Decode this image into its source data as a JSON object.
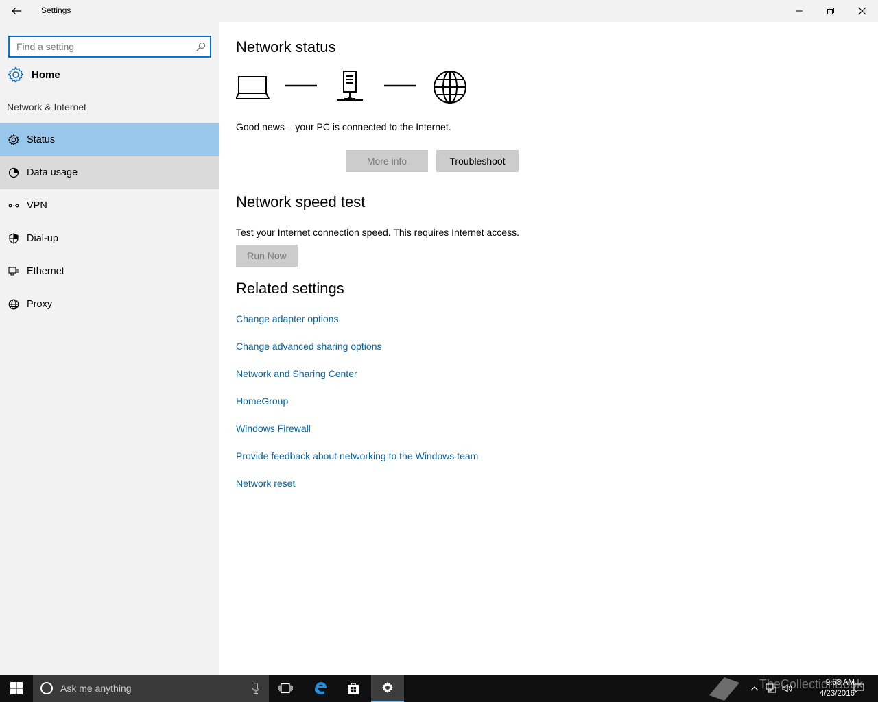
{
  "window": {
    "title": "Settings"
  },
  "sidebar": {
    "search_placeholder": "Find a setting",
    "home_label": "Home",
    "section_title": "Network & Internet",
    "items": [
      {
        "label": "Status",
        "icon": "gear-icon",
        "state": "selected"
      },
      {
        "label": "Data usage",
        "icon": "pie-chart-icon",
        "state": "hover"
      },
      {
        "label": "VPN",
        "icon": "vpn-icon",
        "state": "normal"
      },
      {
        "label": "Dial-up",
        "icon": "dialup-icon",
        "state": "normal"
      },
      {
        "label": "Ethernet",
        "icon": "ethernet-icon",
        "state": "normal"
      },
      {
        "label": "Proxy",
        "icon": "globe-icon",
        "state": "normal"
      }
    ]
  },
  "main": {
    "network_status": {
      "heading": "Network status",
      "status_text": "Good news – your PC is connected to the Internet.",
      "more_info_label": "More info",
      "troubleshoot_label": "Troubleshoot"
    },
    "speed_test": {
      "heading": "Network speed test",
      "description": "Test your Internet connection speed. This requires Internet access.",
      "run_now_label": "Run Now"
    },
    "related": {
      "heading": "Related settings",
      "links": [
        "Change adapter options",
        "Change advanced sharing options",
        "Network and Sharing Center",
        "HomeGroup",
        "Windows Firewall",
        "Provide feedback about networking to the Windows team",
        "Network reset"
      ]
    }
  },
  "taskbar": {
    "search_text": "Ask me anything",
    "time": "9:58 AM",
    "date": "4/23/2016",
    "watermark": "TheCollectionBook"
  },
  "colors": {
    "accent": "#0078d7",
    "link": "#0063b1",
    "selected": "#99c6eb",
    "sidebar_bg": "#f2f2f2",
    "taskbar_bg": "#101010"
  }
}
